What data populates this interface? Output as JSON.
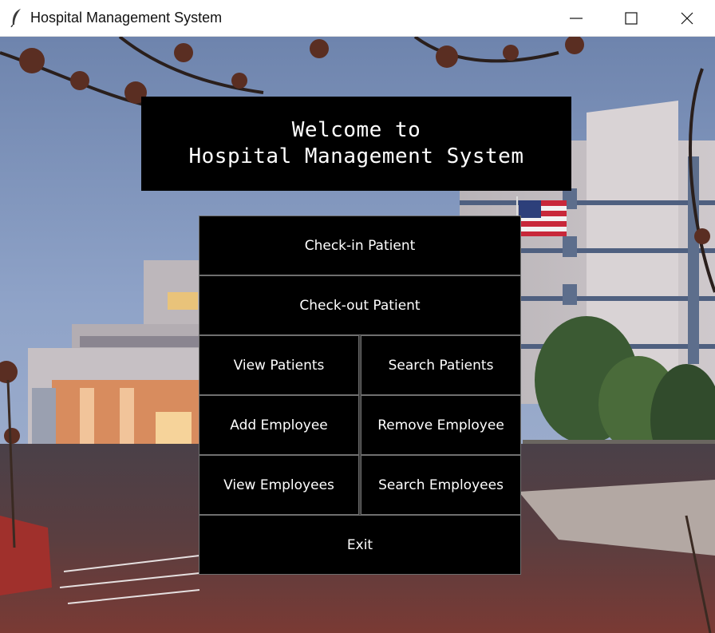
{
  "window": {
    "title": "Hospital Management System",
    "icons": [
      "feather-icon",
      "minimize-icon",
      "maximize-icon",
      "close-icon"
    ]
  },
  "welcome": {
    "line1": "Welcome to",
    "line2": "Hospital Management System"
  },
  "menu": {
    "check_in": "Check-in Patient",
    "check_out": "Check-out Patient",
    "view_patients": "View Patients",
    "search_patients": "Search Patients",
    "add_employee": "Add Employee",
    "remove_employee": "Remove Employee",
    "view_employees": "View Employees",
    "search_employees": "Search Employees",
    "exit": "Exit"
  },
  "colors": {
    "button_bg": "#000000",
    "button_text": "#ffffff",
    "button_border": "#6f6f6f",
    "titlebar_bg": "#ffffff"
  }
}
